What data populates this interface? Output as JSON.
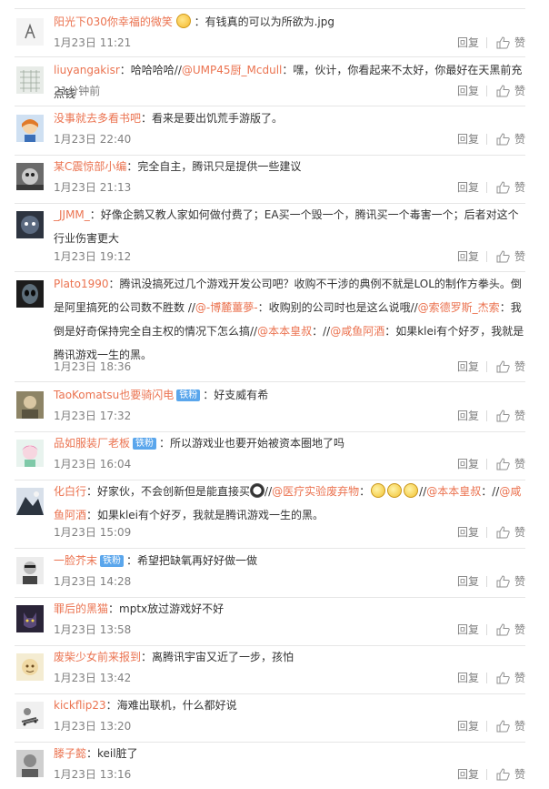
{
  "actions": {
    "reply": "回复",
    "like": "赞"
  },
  "comments": [
    {
      "user": "阳光下030你幸福的微笑",
      "badge": "",
      "text": "：有钱真的可以为所欲为.jpg",
      "time": "1月23日 11:21"
    },
    {
      "user": "liuyangakisr",
      "badge": "",
      "text_pre": "：哈哈哈哈//",
      "mention1": "@UMP45厨_Mcdull",
      "text_post": "：嘿，伙计，你看起来不太好，你最好在天黑前充点钱",
      "time": "21分钟前"
    },
    {
      "user": "没事就去多看书吧",
      "badge": "",
      "text": "：看来是要出饥荒手游版了。",
      "time": "1月23日 22:40"
    },
    {
      "user": "某C震惊部小编",
      "badge": "",
      "text": "：完全自主，腾讯只是提供一些建议",
      "time": "1月23日 21:13"
    },
    {
      "user": "_JJMM_",
      "badge": "",
      "text": "：好像企鹅又教人家如何做付费了；EA买一个毁一个，腾讯买一个毒害一个；后者对这个行业伤害更大",
      "time": "1月23日 19:12"
    },
    {
      "user": "Plato1990",
      "badge": "",
      "text_a": "：腾讯没搞死过几个游戏开发公司吧？收购不干涉的典例不就是LOL的制作方拳头。倒是阿里搞死的公司数不胜数 //",
      "mention_a": "@-博麓薑夢-",
      "text_b": "：收购别的公司时也是这么说哦//",
      "mention_b": "@索德罗斯_杰索",
      "text_c": "：我倒是好奇保持完全自主权的情况下怎么搞//",
      "mention_c": "@本本皇叔",
      "text_d": "：//",
      "mention_d": "@咸鱼阿酒",
      "text_e": "：如果klei有个好歹，我就是腾讯游戏一生的黑。",
      "time": "1月23日 18:36"
    },
    {
      "user": "TaoKomatsu也要骑闪电",
      "badge": "铁粉",
      "text": "：好支威有希",
      "time": "1月23日 17:32"
    },
    {
      "user": "品如服装厂老板",
      "badge": "铁粉",
      "text": "：所以游戏业也要开始被资本圈地了吗",
      "time": "1月23日 16:04"
    },
    {
      "user": "化白行",
      "badge": "",
      "text_a": "：好家伙，不会创新但是能直接买",
      "text_b": "//",
      "mention_a": "@医疗实验废弃物",
      "text_c": "：",
      "text_d": "//",
      "mention_b": "@本本皇叔",
      "text_e": "：//",
      "mention_c": "@咸鱼阿酒",
      "text_f": "：如果klei有个好歹，我就是腾讯游戏一生的黑。",
      "time": "1月23日 15:09"
    },
    {
      "user": "一脸芥末",
      "badge": "铁粉",
      "text": "：希望把缺氧再好好做一做",
      "time": "1月23日 14:28"
    },
    {
      "user": "罪后的黑猫",
      "badge": "",
      "text": "：mptx放过游戏好不好",
      "time": "1月23日 13:58"
    },
    {
      "user": "废柴少女前来报到",
      "badge": "",
      "text": "：离腾讯宇宙又近了一步，孩怕",
      "time": "1月23日 13:42"
    },
    {
      "user": "kickflip23",
      "badge": "",
      "text": "：海难出联机，什么都好说",
      "time": "1月23日 13:20"
    },
    {
      "user": "滕子懿",
      "badge": "",
      "text": "：keil脏了",
      "time": "1月23日 13:16"
    }
  ]
}
